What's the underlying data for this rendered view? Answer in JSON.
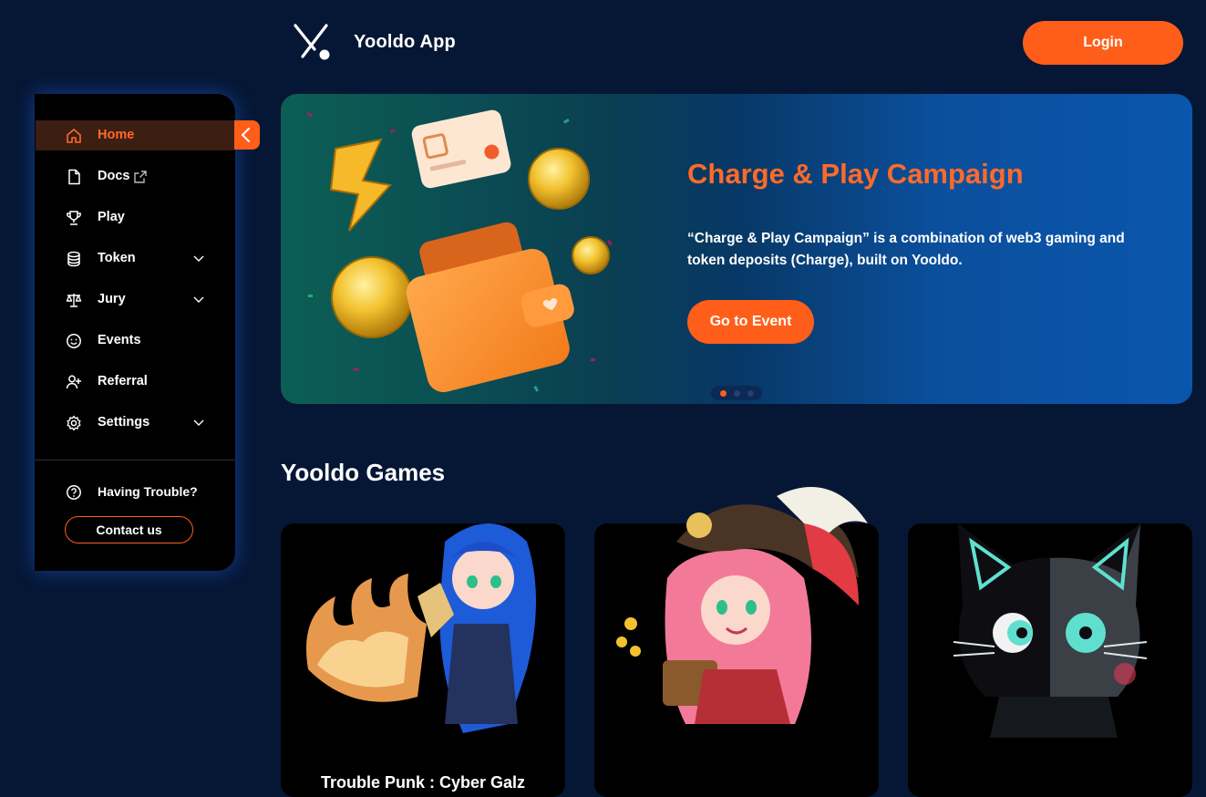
{
  "header": {
    "app_title": "Yooldo App",
    "login_label": "Login"
  },
  "sidebar": {
    "items": [
      {
        "label": "Home",
        "icon": "home-icon",
        "active": true
      },
      {
        "label": "Docs",
        "icon": "document-icon",
        "external": true
      },
      {
        "label": "Play",
        "icon": "trophy-icon"
      },
      {
        "label": "Token",
        "icon": "coins-stack-icon",
        "expandable": true
      },
      {
        "label": "Jury",
        "icon": "scales-icon",
        "expandable": true
      },
      {
        "label": "Events",
        "icon": "smiley-icon"
      },
      {
        "label": "Referral",
        "icon": "add-user-icon"
      },
      {
        "label": "Settings",
        "icon": "gear-icon",
        "expandable": true
      }
    ],
    "help_label": "Having Trouble?",
    "contact_label": "Contact us"
  },
  "banner": {
    "title": "Charge & Play Campaign",
    "description": "“Charge & Play Campaign” is a combination of web3 gaming and token deposits (Charge), built on Yooldo.",
    "cta_label": "Go to Event",
    "slide_count": 3,
    "active_slide": 1
  },
  "games": {
    "section_title": "Yooldo Games",
    "cards": [
      {
        "title": "Trouble Punk : Cyber Galz"
      },
      {
        "title": ""
      },
      {
        "title": ""
      }
    ]
  },
  "colors": {
    "accent": "#ff5e1a",
    "background": "#061735",
    "panel": "#000000"
  }
}
